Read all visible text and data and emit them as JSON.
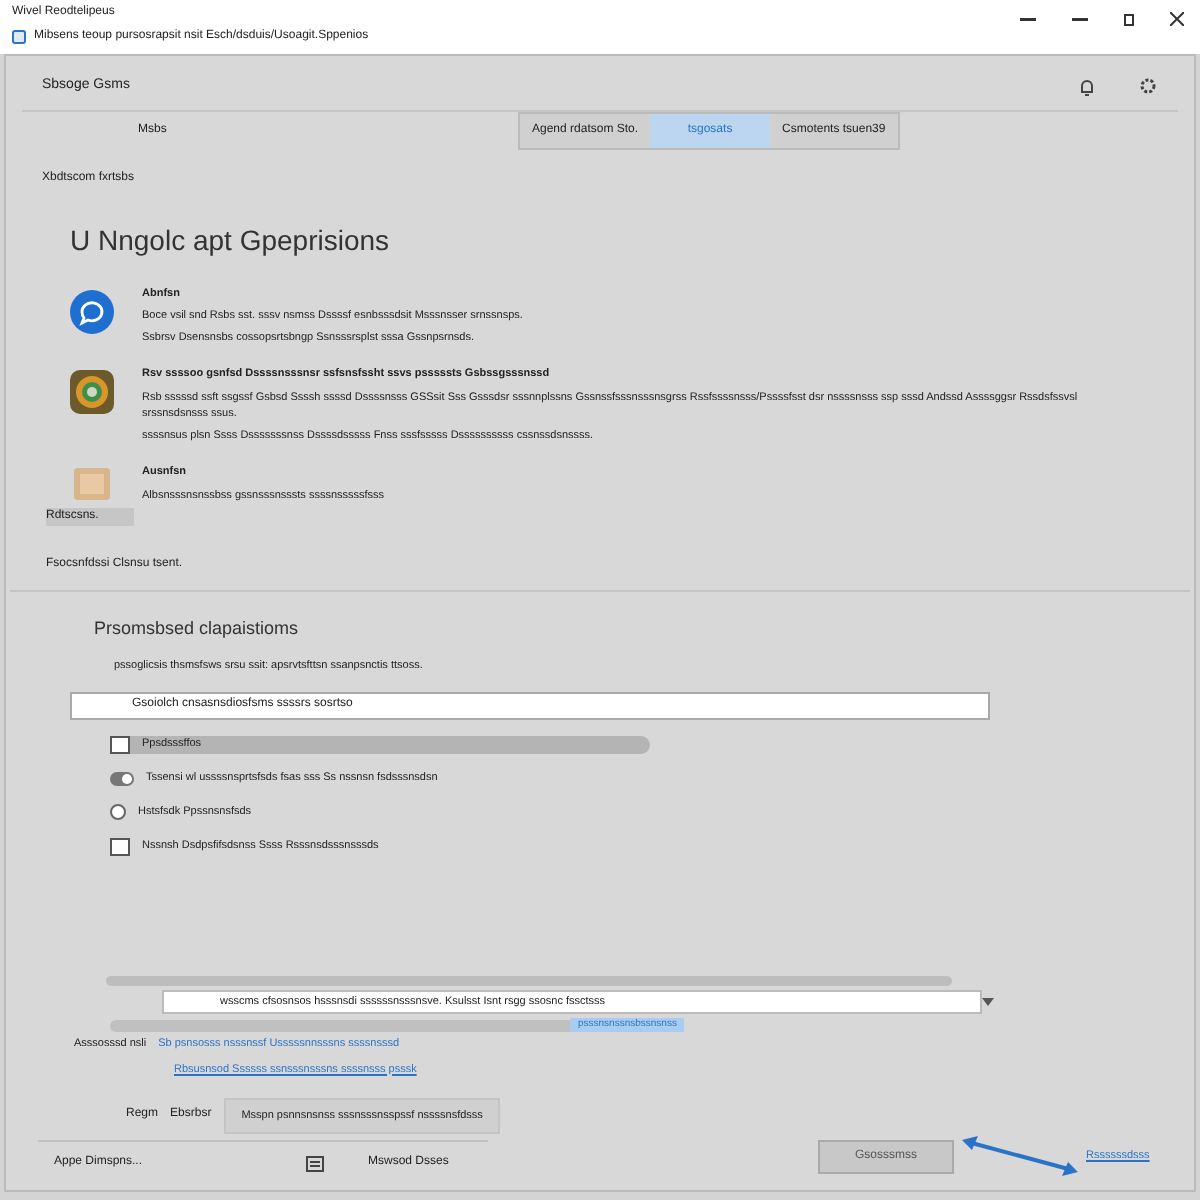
{
  "window": {
    "title": "Wivel Reodtelipeus",
    "address": "Mibsens teoup pursosrapsit nsit Esch/dsduis/Usoagit.Sppenios"
  },
  "header": {
    "title": "Sbsoge Gsms",
    "subtitle": "Msbs"
  },
  "tabs": [
    {
      "label": "Agend rdatsom Sto.",
      "selected": false
    },
    {
      "label": "tsgosats",
      "selected": true
    },
    {
      "label": "Csmotents tsuen39",
      "selected": false
    }
  ],
  "breadcrumb": "Xbdtscom fxrtsbs",
  "heading": "U Nngolc apt Gpeprisions",
  "apps": [
    {
      "kind": "chat",
      "title": "Abnfsn",
      "text": "Boce vsil snd Rsbs sst. sssv nsmss Dssssf esnbsssdsit Msssnsser srnssnsps.",
      "text2": "Ssbrsv Dsensnsbs cossopsrtsbngp Ssnsssrsplst sssa Gssnpsrnsds."
    },
    {
      "kind": "browser",
      "title": "Rsv ssssoo gsnfsd Dssssnsssnsr ssfsnsfssht ssvs psssssts Gsbssgsssnssd",
      "text": "Rsb sssssd ssft ssgssf Gsbsd Ssssh ssssd Dssssnsss GSSsit Sss Gsssdsr sssnnplssns Gssnssfsssnsssnsgrss Rssfssssnsss/Pssssfsst dsr nssssnsss ssp sssd Andssd Assssggsr Rssdsfssvsl srssnsdsnsss ssus.",
      "text2": "ssssnsus plsn Ssss Dsssssssnss Dssssdsssss Fnss sssfsssss Dssssssssss cssnssdsnssss."
    },
    {
      "kind": "package",
      "title": "Ausnfsn",
      "text": "Albsnsssnsnssbss gssnsssnsssts ssssnsssssfsss"
    }
  ],
  "apps_footer": "Rdtscsns.",
  "note": "Fsocsnfdssi Clsnsu tsent.",
  "section": {
    "title": "Prsomsbsed clapaistioms",
    "description": "pssoglicsis thsmsfsws srsu ssit: apsrvtsfttsn ssanpsnctis ttsoss.",
    "field": "Gsoiolch cnsasnsdiosfsms ssssrs sosrtso"
  },
  "options": [
    {
      "kind": "checkbox",
      "label": "Ppsdsssffos",
      "checked": false,
      "selected": true
    },
    {
      "kind": "toggle",
      "label": "Tssensi wl ussssnsprtsfsds fsas sss Ss nssnsn fsdsssnsdsn",
      "checked": true,
      "selected": false
    },
    {
      "kind": "radio",
      "label": "Hstsfsdk Ppssnsnsfsds",
      "checked": false,
      "selected": false
    },
    {
      "kind": "checkbox",
      "label": "Nssnsh Dsdpsfifsdsnss Ssss Rsssnsdsssnsssds",
      "checked": false,
      "selected": false
    }
  ],
  "command": {
    "value": "wsscms cfsosnsos hsssnsdi ssssssnsssnsve. Ksulsst Isnt rsgg ssosnc fssctsss",
    "hint": "psssnsnssnsbssnsnss"
  },
  "assigned": {
    "label": "Asssosssd nsli",
    "link1": "Sb psnsosss nsssnssf Usssssnnsssns ssssnsssd",
    "link2": "Rbsusnsod Ssssss ssnsssnsssns ssssnsss psssk"
  },
  "region": {
    "label": "Regm",
    "value": "Ebsrbsr",
    "button": "Msspn psnnsnsnss sssnsssnsspssf nssssnsfdsss"
  },
  "footer": {
    "left": "Appe Dimspns...",
    "middle": "Mswsod Dsses",
    "primary": "Gsosssmss",
    "link": "Rssssssdsss"
  }
}
